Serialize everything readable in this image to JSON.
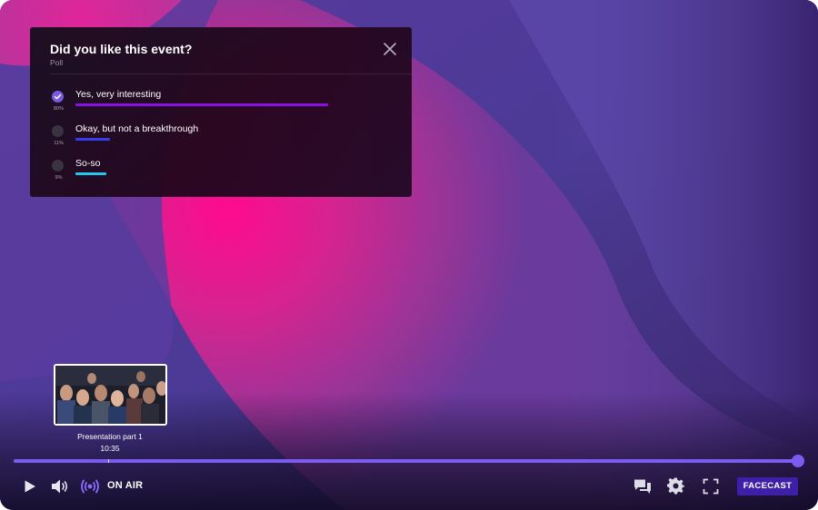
{
  "poll": {
    "title": "Did you like this event?",
    "subtitle": "Poll",
    "options": [
      {
        "label": "Yes, very interesting",
        "percent_text": "80%",
        "percent": 80,
        "selected": true,
        "bar_color": "#8b10e6"
      },
      {
        "label": "Okay, but not a breakthrough",
        "percent_text": "11%",
        "percent": 11,
        "selected": false,
        "bar_color": "#3a3aee"
      },
      {
        "label": "So-so",
        "percent_text": "9%",
        "percent": 9,
        "selected": false,
        "bar_color": "#22c8f0"
      }
    ]
  },
  "preview": {
    "title": "Presentation part 1",
    "time": "10:35"
  },
  "player": {
    "progress": 1.0,
    "marker_fraction": 0.12,
    "accent_color": "#7b5cf0",
    "live_label": "ON AIR",
    "brand_label": "FACECAST"
  },
  "icons": {
    "controls": [
      "play-icon",
      "volume-icon",
      "broadcast-icon",
      "chat-icon",
      "settings-gear-icon",
      "fullscreen-icon",
      "close-icon",
      "check-icon"
    ]
  }
}
